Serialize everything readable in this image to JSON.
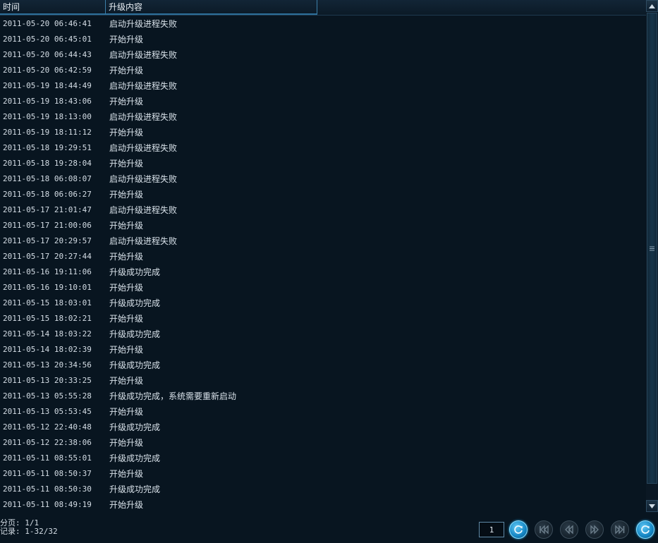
{
  "header": {
    "col_time": "时间",
    "col_content": "升级内容"
  },
  "rows": [
    {
      "time": "2011-05-20 06:46:41",
      "content": "启动升级进程失败"
    },
    {
      "time": "2011-05-20 06:45:01",
      "content": "开始升级"
    },
    {
      "time": "2011-05-20 06:44:43",
      "content": "启动升级进程失败"
    },
    {
      "time": "2011-05-20 06:42:59",
      "content": "开始升级"
    },
    {
      "time": "2011-05-19 18:44:49",
      "content": "启动升级进程失败"
    },
    {
      "time": "2011-05-19 18:43:06",
      "content": "开始升级"
    },
    {
      "time": "2011-05-19 18:13:00",
      "content": "启动升级进程失败"
    },
    {
      "time": "2011-05-19 18:11:12",
      "content": "开始升级"
    },
    {
      "time": "2011-05-18 19:29:51",
      "content": "启动升级进程失败"
    },
    {
      "time": "2011-05-18 19:28:04",
      "content": "开始升级"
    },
    {
      "time": "2011-05-18 06:08:07",
      "content": "启动升级进程失败"
    },
    {
      "time": "2011-05-18 06:06:27",
      "content": "开始升级"
    },
    {
      "time": "2011-05-17 21:01:47",
      "content": "启动升级进程失败"
    },
    {
      "time": "2011-05-17 21:00:06",
      "content": "开始升级"
    },
    {
      "time": "2011-05-17 20:29:57",
      "content": "启动升级进程失败"
    },
    {
      "time": "2011-05-17 20:27:44",
      "content": "开始升级"
    },
    {
      "time": "2011-05-16 19:11:06",
      "content": "升级成功完成"
    },
    {
      "time": "2011-05-16 19:10:01",
      "content": "开始升级"
    },
    {
      "time": "2011-05-15 18:03:01",
      "content": "升级成功完成"
    },
    {
      "time": "2011-05-15 18:02:21",
      "content": "开始升级"
    },
    {
      "time": "2011-05-14 18:03:22",
      "content": "升级成功完成"
    },
    {
      "time": "2011-05-14 18:02:39",
      "content": "开始升级"
    },
    {
      "time": "2011-05-13 20:34:56",
      "content": "升级成功完成"
    },
    {
      "time": "2011-05-13 20:33:25",
      "content": "开始升级"
    },
    {
      "time": "2011-05-13 05:55:28",
      "content": "升级成功完成，系统需要重新启动"
    },
    {
      "time": "2011-05-13 05:53:45",
      "content": "开始升级"
    },
    {
      "time": "2011-05-12 22:40:48",
      "content": "升级成功完成"
    },
    {
      "time": "2011-05-12 22:38:06",
      "content": "开始升级"
    },
    {
      "time": "2011-05-11 08:55:01",
      "content": "升级成功完成"
    },
    {
      "time": "2011-05-11 08:50:37",
      "content": "开始升级"
    },
    {
      "time": "2011-05-11 08:50:30",
      "content": "升级成功完成"
    },
    {
      "time": "2011-05-11 08:49:19",
      "content": "开始升级"
    }
  ],
  "footer": {
    "page_info": "分页: 1/1",
    "record_info": "记录: 1-32/32",
    "page_input_value": "1"
  },
  "icons": {
    "refresh": "refresh-icon",
    "first": "first-page-icon",
    "prev": "previous-page-icon",
    "next": "next-page-icon",
    "last": "last-page-icon",
    "refresh_all": "refresh-icon"
  },
  "colors": {
    "background": "#081520",
    "accent": "#1586c4",
    "header_line": "#2d6f9a"
  }
}
